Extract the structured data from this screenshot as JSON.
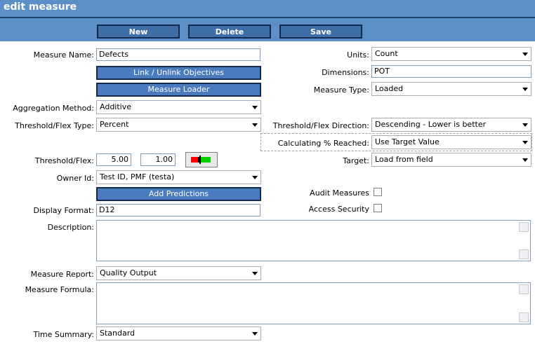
{
  "title": "edit measure",
  "toolbar": {
    "new_label": "New",
    "delete_label": "Delete",
    "save_label": "Save"
  },
  "form": {
    "measure_name": {
      "label": "Measure Name:",
      "value": "Defects"
    },
    "link_objectives_label": "Link / Unlink Objectives",
    "measure_loader_label": "Measure Loader",
    "aggregation_method": {
      "label": "Aggregation Method:",
      "value": "Additive"
    },
    "threshold_flex_type": {
      "label": "Threshold/Flex Type:",
      "value": "Percent"
    },
    "threshold_flex": {
      "label": "Threshold/Flex:",
      "value1": "5.00",
      "value2": "1.00"
    },
    "owner_id": {
      "label": "Owner Id:",
      "value": "Test ID, PMF (testa)"
    },
    "add_predictions_label": "Add Predictions",
    "display_format": {
      "label": "Display Format:",
      "value": "D12"
    },
    "description": {
      "label": "Description:",
      "value": ""
    },
    "measure_report": {
      "label": "Measure Report:",
      "value": "Quality Output"
    },
    "measure_formula": {
      "label": "Measure Formula:",
      "value": ""
    },
    "time_summary": {
      "label": "Time Summary:",
      "value": "Standard"
    },
    "units": {
      "label": "Units:",
      "value": "Count"
    },
    "dimensions": {
      "label": "Dimensions:",
      "value": "POT"
    },
    "measure_type": {
      "label": "Measure Type:",
      "value": "Loaded"
    },
    "threshold_flex_direction": {
      "label": "Threshold/Flex Direction:",
      "value": "Descending - Lower is better"
    },
    "calculating_reached": {
      "label": "Calculating % Reached:",
      "value": "Use Target Value"
    },
    "target": {
      "label": "Target:",
      "value": "Load from field"
    },
    "audit_measures": {
      "label": "Audit Measures",
      "checked": false
    },
    "access_security": {
      "label": "Access Security",
      "checked": false
    }
  },
  "colors": {
    "header": "#5c8fc7",
    "button": "#3f6ea6",
    "gauge_red": "#ff0000",
    "gauge_green": "#00d000"
  }
}
